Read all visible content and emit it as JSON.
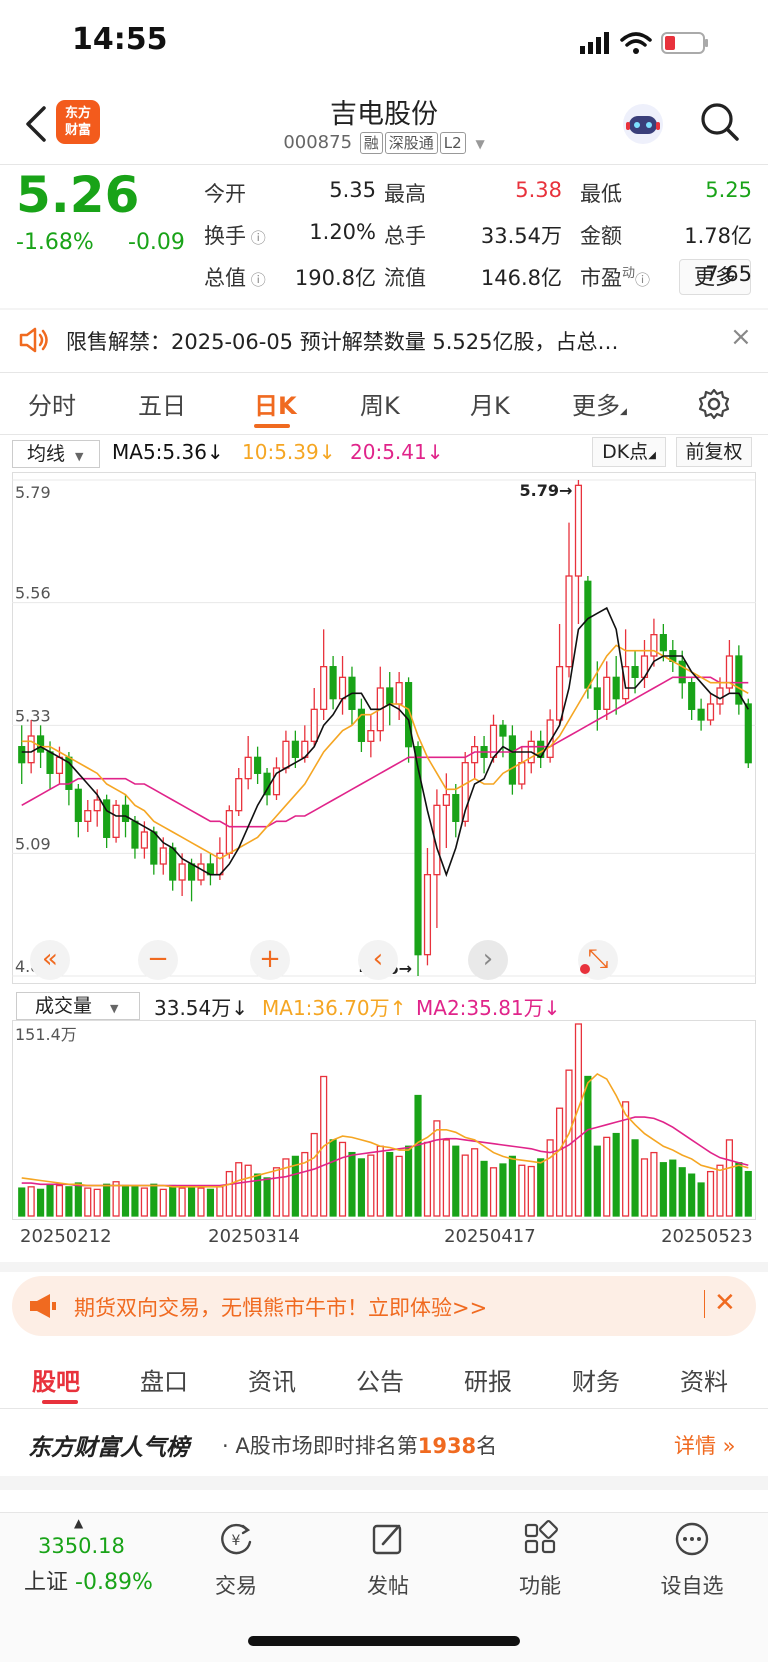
{
  "status_bar": {
    "time": "14:55"
  },
  "header": {
    "logo_line1": "东方",
    "logo_line2": "财富",
    "stock_name": "吉电股份",
    "stock_code": "000875",
    "tags": [
      "融",
      "深股通",
      "L2"
    ]
  },
  "quote": {
    "price": "5.26",
    "pct_change": "-1.68%",
    "change": "-0.09",
    "fields": [
      {
        "label": "今开",
        "value": "5.35",
        "color": "#222222"
      },
      {
        "label": "最高",
        "value": "5.38",
        "color": "#e8323c"
      },
      {
        "label": "最低",
        "value": "5.25",
        "color": "#19a318"
      },
      {
        "label": "换手",
        "value": "1.20%",
        "color": "#222222"
      },
      {
        "label": "总手",
        "value": "33.54万",
        "color": "#222222"
      },
      {
        "label": "金额",
        "value": "1.78亿",
        "color": "#222222"
      },
      {
        "label": "总值",
        "value": "190.8亿",
        "color": "#222222"
      },
      {
        "label": "流值",
        "value": "146.8亿",
        "color": "#222222"
      },
      {
        "label": "市盈",
        "value": "7.65",
        "color": "#222222"
      }
    ],
    "pe_superscript": "动",
    "more_label": "更多"
  },
  "notice": {
    "text": "限售解禁：2025-06-05 预计解禁数量 5.525亿股，占总…"
  },
  "kline_tabs": [
    "分时",
    "五日",
    "日K",
    "周K",
    "月K",
    "更多"
  ],
  "active_tab_index": 2,
  "ma_row": {
    "select_label": "均线",
    "ma5": "MA5:5.36↓",
    "ma10": "10:5.39↓",
    "ma20": "20:5.41↓",
    "dk_label": "DK点",
    "adjust_label": "前复权"
  },
  "volume_row": {
    "select_label": "成交量",
    "volume": "33.54万↓",
    "ma1": "MA1:36.70万↑",
    "ma2": "MA2:35.81万↓"
  },
  "chart_data": {
    "type": "candlestick",
    "y_ticks": [
      "5.79",
      "5.56",
      "5.33",
      "5.09",
      "4.86"
    ],
    "ylim": [
      4.86,
      5.79
    ],
    "high_marker": "5.79→",
    "low_marker": "4.86→",
    "volume_max_label": "151.4万",
    "volume_max": 151.4,
    "date_labels": [
      "20250212",
      "20250314",
      "20250417",
      "20250523"
    ],
    "colors": {
      "up": "#e8323c",
      "down": "#19a318",
      "ma5": "#111111",
      "ma10": "#f5a623",
      "ma20": "#e0248a"
    },
    "candles": [
      [
        5.29,
        5.26,
        5.33,
        5.22
      ],
      [
        5.26,
        5.31,
        5.34,
        5.24
      ],
      [
        5.31,
        5.28,
        5.33,
        5.25
      ],
      [
        5.28,
        5.24,
        5.3,
        5.21
      ],
      [
        5.24,
        5.27,
        5.29,
        5.22
      ],
      [
        5.27,
        5.21,
        5.28,
        5.18
      ],
      [
        5.21,
        5.15,
        5.22,
        5.12
      ],
      [
        5.15,
        5.17,
        5.19,
        5.13
      ],
      [
        5.17,
        5.19,
        5.21,
        5.14
      ],
      [
        5.19,
        5.12,
        5.2,
        5.1
      ],
      [
        5.12,
        5.18,
        5.19,
        5.11
      ],
      [
        5.18,
        5.15,
        5.2,
        5.12
      ],
      [
        5.15,
        5.1,
        5.16,
        5.08
      ],
      [
        5.1,
        5.13,
        5.15,
        5.08
      ],
      [
        5.13,
        5.07,
        5.14,
        5.05
      ],
      [
        5.07,
        5.1,
        5.12,
        5.05
      ],
      [
        5.1,
        5.04,
        5.11,
        5.02
      ],
      [
        5.04,
        5.07,
        5.09,
        5.01
      ],
      [
        5.07,
        5.04,
        5.08,
        5.0
      ],
      [
        5.04,
        5.07,
        5.09,
        5.03
      ],
      [
        5.07,
        5.05,
        5.09,
        5.03
      ],
      [
        5.05,
        5.09,
        5.12,
        5.04
      ],
      [
        5.09,
        5.17,
        5.18,
        5.08
      ],
      [
        5.17,
        5.23,
        5.25,
        5.16
      ],
      [
        5.23,
        5.27,
        5.31,
        5.21
      ],
      [
        5.27,
        5.24,
        5.29,
        5.22
      ],
      [
        5.24,
        5.2,
        5.25,
        5.18
      ],
      [
        5.2,
        5.25,
        5.27,
        5.19
      ],
      [
        5.25,
        5.3,
        5.32,
        5.24
      ],
      [
        5.3,
        5.27,
        5.32,
        5.25
      ],
      [
        5.27,
        5.3,
        5.33,
        5.26
      ],
      [
        5.3,
        5.36,
        5.4,
        5.29
      ],
      [
        5.36,
        5.44,
        5.51,
        5.34
      ],
      [
        5.44,
        5.38,
        5.46,
        5.36
      ],
      [
        5.38,
        5.42,
        5.46,
        5.35
      ],
      [
        5.42,
        5.36,
        5.44,
        5.33
      ],
      [
        5.36,
        5.3,
        5.38,
        5.28
      ],
      [
        5.3,
        5.32,
        5.35,
        5.27
      ],
      [
        5.32,
        5.4,
        5.44,
        5.3
      ],
      [
        5.4,
        5.37,
        5.43,
        5.33
      ],
      [
        5.37,
        5.41,
        5.43,
        5.34
      ],
      [
        5.41,
        5.29,
        5.42,
        5.26
      ],
      [
        5.29,
        4.9,
        5.3,
        4.86
      ],
      [
        4.9,
        5.05,
        5.1,
        4.88
      ],
      [
        5.05,
        5.18,
        5.21,
        4.95
      ],
      [
        5.18,
        5.2,
        5.24,
        5.1
      ],
      [
        5.2,
        5.15,
        5.22,
        5.12
      ],
      [
        5.15,
        5.26,
        5.28,
        5.14
      ],
      [
        5.26,
        5.29,
        5.31,
        5.23
      ],
      [
        5.29,
        5.27,
        5.31,
        5.24
      ],
      [
        5.27,
        5.33,
        5.35,
        5.26
      ],
      [
        5.33,
        5.31,
        5.34,
        5.27
      ],
      [
        5.31,
        5.22,
        5.33,
        5.2
      ],
      [
        5.22,
        5.26,
        5.29,
        5.21
      ],
      [
        5.26,
        5.3,
        5.32,
        5.24
      ],
      [
        5.3,
        5.27,
        5.32,
        5.25
      ],
      [
        5.27,
        5.34,
        5.36,
        5.26
      ],
      [
        5.34,
        5.44,
        5.52,
        5.33
      ],
      [
        5.44,
        5.61,
        5.71,
        5.42
      ],
      [
        5.61,
        5.78,
        5.79,
        5.52
      ],
      [
        5.6,
        5.4,
        5.61,
        5.38
      ],
      [
        5.4,
        5.36,
        5.45,
        5.32
      ],
      [
        5.36,
        5.42,
        5.45,
        5.34
      ],
      [
        5.42,
        5.38,
        5.46,
        5.35
      ],
      [
        5.38,
        5.44,
        5.51,
        5.37
      ],
      [
        5.44,
        5.42,
        5.47,
        5.39
      ],
      [
        5.42,
        5.46,
        5.49,
        5.4
      ],
      [
        5.46,
        5.5,
        5.53,
        5.44
      ],
      [
        5.5,
        5.47,
        5.52,
        5.45
      ],
      [
        5.47,
        5.45,
        5.49,
        5.43
      ],
      [
        5.45,
        5.41,
        5.47,
        5.38
      ],
      [
        5.41,
        5.36,
        5.42,
        5.34
      ],
      [
        5.36,
        5.34,
        5.38,
        5.32
      ],
      [
        5.34,
        5.37,
        5.39,
        5.33
      ],
      [
        5.37,
        5.4,
        5.42,
        5.35
      ],
      [
        5.4,
        5.46,
        5.49,
        5.39
      ],
      [
        5.46,
        5.37,
        5.48,
        5.35
      ],
      [
        5.37,
        5.26,
        5.38,
        5.25
      ]
    ],
    "volumes": [
      22,
      23,
      21,
      25,
      24,
      23,
      26,
      22,
      21,
      25,
      27,
      24,
      23,
      22,
      25,
      21,
      24,
      22,
      23,
      22,
      21,
      23,
      35,
      42,
      40,
      33,
      30,
      38,
      45,
      47,
      50,
      65,
      110,
      60,
      58,
      50,
      45,
      48,
      55,
      50,
      47,
      55,
      95,
      58,
      75,
      60,
      55,
      48,
      53,
      43,
      38,
      41,
      47,
      40,
      39,
      45,
      60,
      85,
      115,
      151.4,
      110,
      55,
      62,
      65,
      90,
      60,
      45,
      50,
      42,
      44,
      38,
      33,
      26,
      35,
      40,
      60,
      42,
      35
    ],
    "ma5_line": [
      5.28,
      5.28,
      5.29,
      5.28,
      5.27,
      5.26,
      5.24,
      5.22,
      5.2,
      5.17,
      5.16,
      5.16,
      5.15,
      5.14,
      5.13,
      5.11,
      5.1,
      5.08,
      5.07,
      5.06,
      5.05,
      5.05,
      5.07,
      5.1,
      5.14,
      5.18,
      5.21,
      5.24,
      5.25,
      5.26,
      5.27,
      5.29,
      5.33,
      5.35,
      5.38,
      5.39,
      5.39,
      5.36,
      5.36,
      5.37,
      5.36,
      5.34,
      5.25,
      5.17,
      5.1,
      5.05,
      5.1,
      5.17,
      5.22,
      5.23,
      5.27,
      5.29,
      5.28,
      5.28,
      5.28,
      5.27,
      5.3,
      5.33,
      5.4,
      5.51,
      5.53,
      5.54,
      5.55,
      5.51,
      5.4,
      5.4,
      5.42,
      5.45,
      5.46,
      5.46,
      5.46,
      5.43,
      5.41,
      5.39,
      5.38,
      5.39,
      5.39,
      5.36
    ],
    "ma10_line": [
      5.3,
      5.3,
      5.29,
      5.29,
      5.28,
      5.27,
      5.26,
      5.25,
      5.24,
      5.22,
      5.21,
      5.2,
      5.18,
      5.17,
      5.15,
      5.14,
      5.13,
      5.12,
      5.11,
      5.1,
      5.09,
      5.08,
      5.09,
      5.1,
      5.11,
      5.12,
      5.14,
      5.16,
      5.18,
      5.2,
      5.22,
      5.25,
      5.28,
      5.3,
      5.32,
      5.33,
      5.35,
      5.35,
      5.36,
      5.37,
      5.37,
      5.36,
      5.31,
      5.27,
      5.24,
      5.21,
      5.21,
      5.22,
      5.23,
      5.22,
      5.22,
      5.24,
      5.25,
      5.26,
      5.27,
      5.28,
      5.29,
      5.31,
      5.34,
      5.37,
      5.4,
      5.43,
      5.46,
      5.48,
      5.47,
      5.47,
      5.47,
      5.47,
      5.46,
      5.45,
      5.44,
      5.43,
      5.42,
      5.41,
      5.41,
      5.41,
      5.4,
      5.39
    ],
    "ma20_line": [
      5.18,
      5.19,
      5.2,
      5.21,
      5.22,
      5.22,
      5.23,
      5.23,
      5.23,
      5.23,
      5.23,
      5.23,
      5.22,
      5.22,
      5.21,
      5.2,
      5.19,
      5.18,
      5.17,
      5.16,
      5.15,
      5.15,
      5.14,
      5.14,
      5.14,
      5.14,
      5.14,
      5.15,
      5.15,
      5.16,
      5.16,
      5.17,
      5.18,
      5.19,
      5.2,
      5.21,
      5.22,
      5.23,
      5.24,
      5.25,
      5.26,
      5.27,
      5.27,
      5.27,
      5.27,
      5.27,
      5.27,
      5.27,
      5.28,
      5.28,
      5.28,
      5.28,
      5.28,
      5.29,
      5.29,
      5.29,
      5.29,
      5.3,
      5.31,
      5.32,
      5.33,
      5.34,
      5.35,
      5.36,
      5.37,
      5.38,
      5.39,
      5.4,
      5.41,
      5.42,
      5.42,
      5.42,
      5.42,
      5.42,
      5.41,
      5.41,
      5.41,
      5.41
    ],
    "vma1_line": [
      30,
      29,
      28,
      27,
      26,
      25,
      25,
      24,
      24,
      24,
      24,
      24,
      24,
      24,
      24,
      24,
      23,
      23,
      23,
      23,
      23,
      23,
      25,
      28,
      30,
      32,
      34,
      36,
      38,
      40,
      42,
      46,
      55,
      60,
      63,
      62,
      60,
      58,
      55,
      54,
      52,
      52,
      58,
      62,
      68,
      68,
      66,
      62,
      60,
      55,
      50,
      47,
      45,
      44,
      43,
      42,
      46,
      52,
      65,
      85,
      105,
      112,
      108,
      95,
      80,
      72,
      65,
      60,
      55,
      52,
      48,
      45,
      40,
      38,
      36,
      38,
      40,
      38
    ],
    "vma2_line": [
      26,
      26,
      25,
      25,
      25,
      25,
      24,
      24,
      24,
      24,
      24,
      24,
      24,
      24,
      24,
      24,
      24,
      24,
      24,
      24,
      24,
      24,
      25,
      26,
      27,
      28,
      29,
      30,
      31,
      33,
      35,
      37,
      40,
      43,
      46,
      48,
      49,
      50,
      51,
      52,
      53,
      54,
      56,
      58,
      60,
      61,
      61,
      60,
      59,
      58,
      57,
      56,
      55,
      54,
      53,
      51,
      50,
      52,
      56,
      62,
      68,
      70,
      72,
      74,
      76,
      78,
      78,
      77,
      74,
      70,
      65,
      60,
      55,
      50,
      46,
      44,
      42,
      40
    ]
  },
  "chart_controls": [
    "«",
    "−",
    "+",
    "‹",
    "›",
    "⤡"
  ],
  "ad": {
    "text": "期货双向交易，无惧熊市牛市！立即体验>>",
    "close": "✕"
  },
  "bottom_tabs": [
    "股吧",
    "盘口",
    "资讯",
    "公告",
    "研报",
    "财务",
    "资料"
  ],
  "rank": {
    "brand": "东方财富人气榜",
    "text_prefix": "· A股市场即时排名第",
    "rank_number": "1938",
    "text_suffix": "名",
    "detail": "详情 »"
  },
  "bottom_nav": {
    "index_value": "3350.18",
    "index_name": "上证",
    "index_change": "-0.89%",
    "items": [
      {
        "label": "交易",
        "icon": "trade-icon"
      },
      {
        "label": "发帖",
        "icon": "post-icon"
      },
      {
        "label": "功能",
        "icon": "function-icon"
      },
      {
        "label": "设自选",
        "icon": "watchlist-icon"
      }
    ]
  }
}
